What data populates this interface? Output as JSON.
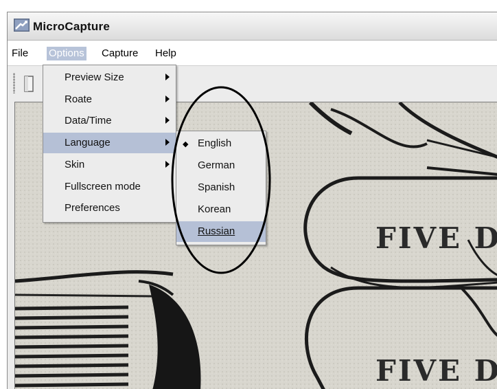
{
  "window": {
    "title": "MicroCapture",
    "icon": "app-camera-icon"
  },
  "menubar": {
    "items": [
      {
        "label": "File"
      },
      {
        "label": "Options"
      },
      {
        "label": "Capture"
      },
      {
        "label": "Help"
      }
    ]
  },
  "options_menu": {
    "items": [
      {
        "label": "Preview Size",
        "submenu": true
      },
      {
        "label": "Roate",
        "submenu": true
      },
      {
        "label": "Data/Time",
        "submenu": true
      },
      {
        "label": "Language",
        "submenu": true
      },
      {
        "label": "Skin",
        "submenu": true
      },
      {
        "label": "Fullscreen mode",
        "submenu": false
      },
      {
        "label": "Preferences",
        "submenu": false
      }
    ]
  },
  "language_menu": {
    "selected": "English",
    "items": [
      {
        "label": "English"
      },
      {
        "label": "German"
      },
      {
        "label": "Spanish"
      },
      {
        "label": "Korean"
      },
      {
        "label": "Russian"
      }
    ]
  },
  "preview": {
    "text_top": "FIVE DO",
    "text_bottom": "FIVE DO"
  },
  "colors": {
    "highlight": "#b5c0d6",
    "menubar_active": "#b7c3d9",
    "annotation": "#000000"
  }
}
